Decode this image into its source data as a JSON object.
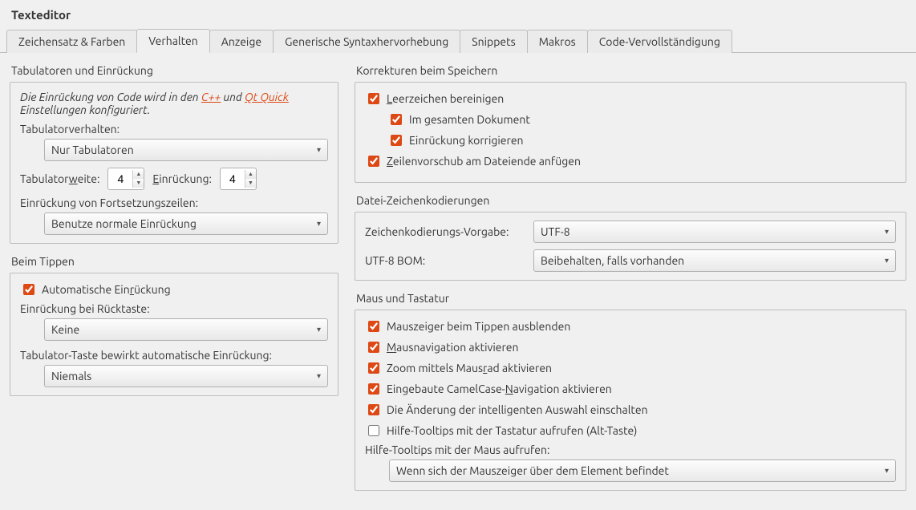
{
  "title": "Texteditor",
  "tabs": [
    "Zeichensatz & Farben",
    "Verhalten",
    "Anzeige",
    "Generische Syntaxhervorhebung",
    "Snippets",
    "Makros",
    "Code-Vervollständigung"
  ],
  "active": 1,
  "left": {
    "tabs_title": "Tabulatoren und Einrückung",
    "note_a": "Die Einrückung von Code wird in den ",
    "note_link1": "C++",
    "note_mid": " und ",
    "note_link2": "Qt Quick",
    "note_b": " Einstellungen konfiguriert.",
    "tab_behavior_label": "Tabulatorverhalten:",
    "tab_behavior_value": "Nur Tabulatoren",
    "tab_width_label_a": "Tabulator",
    "tab_width_label_b": "eite:",
    "tab_width": "4",
    "indent_label_a": "E",
    "indent_label_b": "inrückung:",
    "indent": "4",
    "cont_label": "Einrückung von Fortsetzungszeilen:",
    "cont_value": "Benutze normale Einrückung",
    "typing_title": "Beim Tippen",
    "auto_indent_a": "Automatische Ein",
    "auto_indent_b": "ückung",
    "backspace_label": "Einrückung bei Rücktaste:",
    "backspace_value": "Keine",
    "tabkey_label": "Tabulator-Taste bewirkt automatische Einrückung:",
    "tabkey_value": "Niemals"
  },
  "right": {
    "save_title": "Korrekturen beim Speichern",
    "clean_ws_a": "L",
    "clean_ws_b": "eerzeichen bereinigen",
    "whole_doc_a": "Im ",
    "whole_doc_b": "esamten Dokument",
    "fix_indent": "Einrückung korrigieren",
    "newline_a": "Z",
    "newline_b": "eilenvorschub am Dateiende anfügen",
    "enc_title": "Datei-Zeichenkodierungen",
    "enc_default_label": "Zeichenkodierungs-Vorgabe:",
    "enc_default_value": "UTF-8",
    "bom_label": "UTF-8 BOM:",
    "bom_value": "Beibehalten, falls vorhanden",
    "mouse_title": "Maus und Tastatur",
    "hide_cursor": "Mauszeiger beim Tippen ausblenden",
    "mouse_nav_a": "M",
    "mouse_nav_b": "ausnavigation aktivieren",
    "zoom_a": "Zoom mittels Maus",
    "zoom_b": "ad aktivieren",
    "camel_a": "Eingebaute CamelCase-",
    "camel_b": "avigation aktivieren",
    "smart_sel": "Die Änderung der intelligenten Auswahl einschalten",
    "kb_tooltip": "Hilfe-Tooltips mit der Tastatur aufrufen (Alt-Taste)",
    "mouse_tooltip_label": "Hilfe-Tooltips mit der Maus aufrufen:",
    "mouse_tooltip_value": "Wenn sich der Mauszeiger über dem Element befindet"
  }
}
